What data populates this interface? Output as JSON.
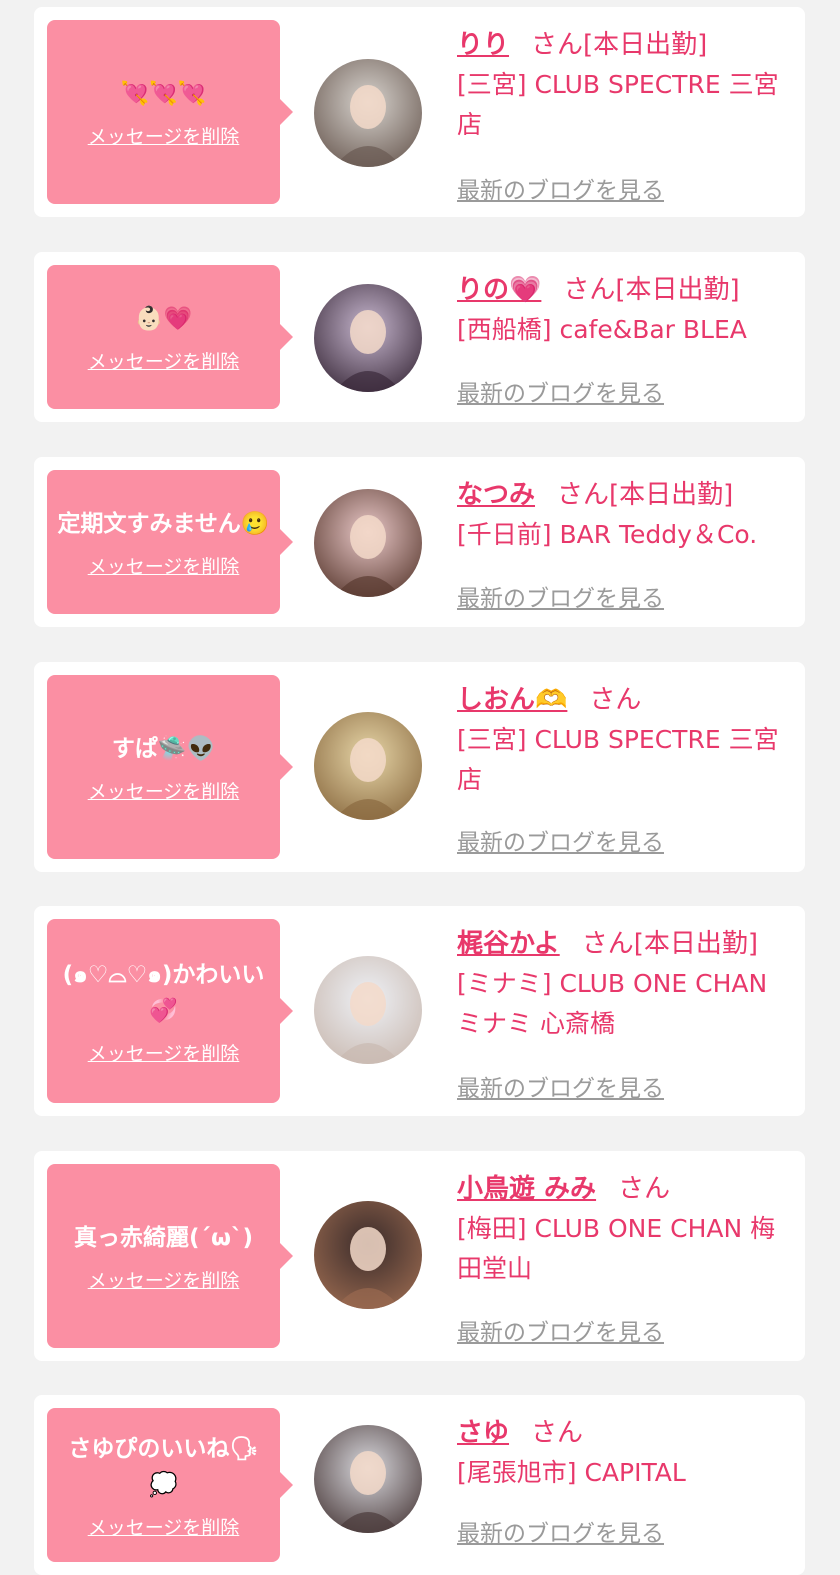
{
  "messages": [
    {
      "message": "💘💘💘",
      "delete_label": "メッセージを削除",
      "name": "りり",
      "honorific": "さん",
      "status": "[本日出勤]",
      "shop": "[三宮] CLUB SPECTRE 三宮店",
      "blog_label": "最新のブログを見る",
      "avatar_colors": [
        "#d8d4cf",
        "#6a5a52"
      ]
    },
    {
      "message": "👶🏻💗",
      "delete_label": "メッセージを削除",
      "name": "りの💗",
      "honorific": "さん",
      "status": "[本日出勤]",
      "shop": "[西船橋] cafe&Bar BLEA",
      "blog_label": "最新のブログを見る",
      "avatar_colors": [
        "#c7b7cf",
        "#3a2a3a"
      ]
    },
    {
      "message": "定期文すみません🥲",
      "delete_label": "メッセージを削除",
      "name": "なつみ",
      "honorific": "さん",
      "status": "[本日出勤]",
      "shop": "[千日前] BAR Teddy＆Co.",
      "blog_label": "最新のブログを見る",
      "avatar_colors": [
        "#e9c8c8",
        "#5a3a30"
      ]
    },
    {
      "message": "すぱ🛸👽",
      "delete_label": "メッセージを削除",
      "name": "しおん🫶",
      "honorific": "さん",
      "status": "",
      "shop": "[三宮] CLUB SPECTRE 三宮店",
      "blog_label": "最新のブログを見る",
      "avatar_colors": [
        "#e7d6a8",
        "#8a6a40"
      ]
    },
    {
      "message": "(๑♡⌓♡๑)かわいい💞",
      "delete_label": "メッセージを削除",
      "name": "梶谷かよ",
      "honorific": "さん",
      "status": "[本日出勤]",
      "shop": "[ミナミ] CLUB ONE CHAN ミナミ 心斎橋",
      "blog_label": "最新のブログを見る",
      "avatar_colors": [
        "#eef1f6",
        "#c9b9b0"
      ]
    },
    {
      "message": "真っ赤綺麗(´ω`)",
      "delete_label": "メッセージを削除",
      "name": "小鳥遊 みみ",
      "honorific": "さん",
      "status": "",
      "shop": "[梅田] CLUB ONE CHAN 梅田堂山",
      "blog_label": "最新のブログを見る",
      "avatar_colors": [
        "#3a2b2a",
        "#9a6a50"
      ]
    },
    {
      "message": "さゆぴのいいね🗣💭",
      "delete_label": "メッセージを削除",
      "name": "さゆ",
      "honorific": "さん",
      "status": "",
      "shop": "[尾張旭市] CAPITAL",
      "blog_label": "最新のブログを見る",
      "avatar_colors": [
        "#d9d9de",
        "#4a3a3a"
      ]
    }
  ]
}
